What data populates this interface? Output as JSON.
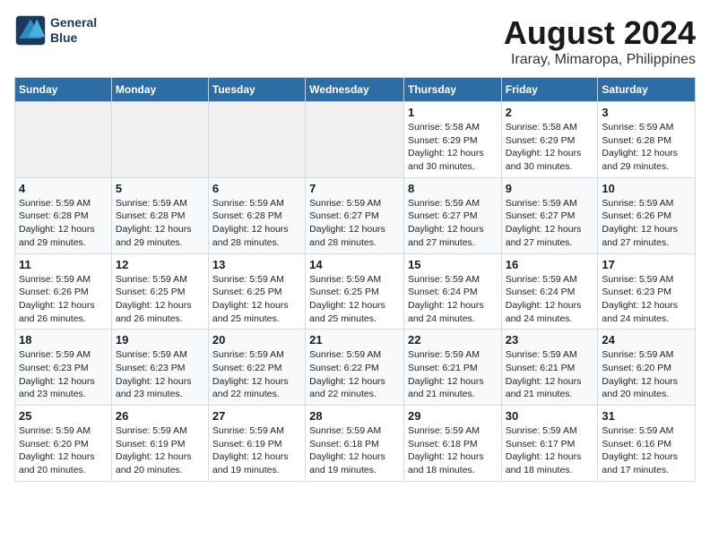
{
  "logo": {
    "line1": "General",
    "line2": "Blue"
  },
  "title": "August 2024",
  "subtitle": "Iraray, Mimaropa, Philippines",
  "weekdays": [
    "Sunday",
    "Monday",
    "Tuesday",
    "Wednesday",
    "Thursday",
    "Friday",
    "Saturday"
  ],
  "weeks": [
    [
      {
        "day": "",
        "info": ""
      },
      {
        "day": "",
        "info": ""
      },
      {
        "day": "",
        "info": ""
      },
      {
        "day": "",
        "info": ""
      },
      {
        "day": "1",
        "info": "Sunrise: 5:58 AM\nSunset: 6:29 PM\nDaylight: 12 hours\nand 30 minutes."
      },
      {
        "day": "2",
        "info": "Sunrise: 5:58 AM\nSunset: 6:29 PM\nDaylight: 12 hours\nand 30 minutes."
      },
      {
        "day": "3",
        "info": "Sunrise: 5:59 AM\nSunset: 6:28 PM\nDaylight: 12 hours\nand 29 minutes."
      }
    ],
    [
      {
        "day": "4",
        "info": "Sunrise: 5:59 AM\nSunset: 6:28 PM\nDaylight: 12 hours\nand 29 minutes."
      },
      {
        "day": "5",
        "info": "Sunrise: 5:59 AM\nSunset: 6:28 PM\nDaylight: 12 hours\nand 29 minutes."
      },
      {
        "day": "6",
        "info": "Sunrise: 5:59 AM\nSunset: 6:28 PM\nDaylight: 12 hours\nand 28 minutes."
      },
      {
        "day": "7",
        "info": "Sunrise: 5:59 AM\nSunset: 6:27 PM\nDaylight: 12 hours\nand 28 minutes."
      },
      {
        "day": "8",
        "info": "Sunrise: 5:59 AM\nSunset: 6:27 PM\nDaylight: 12 hours\nand 27 minutes."
      },
      {
        "day": "9",
        "info": "Sunrise: 5:59 AM\nSunset: 6:27 PM\nDaylight: 12 hours\nand 27 minutes."
      },
      {
        "day": "10",
        "info": "Sunrise: 5:59 AM\nSunset: 6:26 PM\nDaylight: 12 hours\nand 27 minutes."
      }
    ],
    [
      {
        "day": "11",
        "info": "Sunrise: 5:59 AM\nSunset: 6:26 PM\nDaylight: 12 hours\nand 26 minutes."
      },
      {
        "day": "12",
        "info": "Sunrise: 5:59 AM\nSunset: 6:25 PM\nDaylight: 12 hours\nand 26 minutes."
      },
      {
        "day": "13",
        "info": "Sunrise: 5:59 AM\nSunset: 6:25 PM\nDaylight: 12 hours\nand 25 minutes."
      },
      {
        "day": "14",
        "info": "Sunrise: 5:59 AM\nSunset: 6:25 PM\nDaylight: 12 hours\nand 25 minutes."
      },
      {
        "day": "15",
        "info": "Sunrise: 5:59 AM\nSunset: 6:24 PM\nDaylight: 12 hours\nand 24 minutes."
      },
      {
        "day": "16",
        "info": "Sunrise: 5:59 AM\nSunset: 6:24 PM\nDaylight: 12 hours\nand 24 minutes."
      },
      {
        "day": "17",
        "info": "Sunrise: 5:59 AM\nSunset: 6:23 PM\nDaylight: 12 hours\nand 24 minutes."
      }
    ],
    [
      {
        "day": "18",
        "info": "Sunrise: 5:59 AM\nSunset: 6:23 PM\nDaylight: 12 hours\nand 23 minutes."
      },
      {
        "day": "19",
        "info": "Sunrise: 5:59 AM\nSunset: 6:23 PM\nDaylight: 12 hours\nand 23 minutes."
      },
      {
        "day": "20",
        "info": "Sunrise: 5:59 AM\nSunset: 6:22 PM\nDaylight: 12 hours\nand 22 minutes."
      },
      {
        "day": "21",
        "info": "Sunrise: 5:59 AM\nSunset: 6:22 PM\nDaylight: 12 hours\nand 22 minutes."
      },
      {
        "day": "22",
        "info": "Sunrise: 5:59 AM\nSunset: 6:21 PM\nDaylight: 12 hours\nand 21 minutes."
      },
      {
        "day": "23",
        "info": "Sunrise: 5:59 AM\nSunset: 6:21 PM\nDaylight: 12 hours\nand 21 minutes."
      },
      {
        "day": "24",
        "info": "Sunrise: 5:59 AM\nSunset: 6:20 PM\nDaylight: 12 hours\nand 20 minutes."
      }
    ],
    [
      {
        "day": "25",
        "info": "Sunrise: 5:59 AM\nSunset: 6:20 PM\nDaylight: 12 hours\nand 20 minutes."
      },
      {
        "day": "26",
        "info": "Sunrise: 5:59 AM\nSunset: 6:19 PM\nDaylight: 12 hours\nand 20 minutes."
      },
      {
        "day": "27",
        "info": "Sunrise: 5:59 AM\nSunset: 6:19 PM\nDaylight: 12 hours\nand 19 minutes."
      },
      {
        "day": "28",
        "info": "Sunrise: 5:59 AM\nSunset: 6:18 PM\nDaylight: 12 hours\nand 19 minutes."
      },
      {
        "day": "29",
        "info": "Sunrise: 5:59 AM\nSunset: 6:18 PM\nDaylight: 12 hours\nand 18 minutes."
      },
      {
        "day": "30",
        "info": "Sunrise: 5:59 AM\nSunset: 6:17 PM\nDaylight: 12 hours\nand 18 minutes."
      },
      {
        "day": "31",
        "info": "Sunrise: 5:59 AM\nSunset: 6:16 PM\nDaylight: 12 hours\nand 17 minutes."
      }
    ]
  ]
}
